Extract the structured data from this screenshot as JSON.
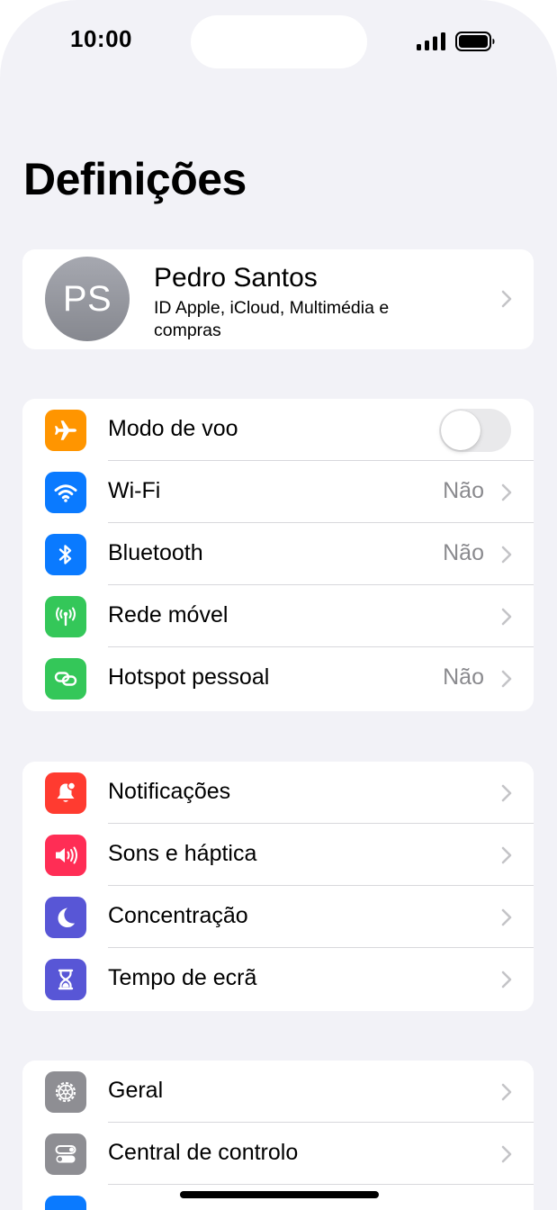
{
  "status": {
    "time": "10:00"
  },
  "page": {
    "title": "Definições"
  },
  "profile": {
    "initials": "PS",
    "name": "Pedro Santos",
    "subtitle": "ID Apple, iCloud, Multimédia e compras"
  },
  "connectivity": {
    "airplane": {
      "label": "Modo de voo",
      "toggle_on": false,
      "icon": "airplane-icon",
      "color": "#ff9500"
    },
    "wifi": {
      "label": "Wi-Fi",
      "value": "Não",
      "icon": "wifi-icon",
      "color": "#0a7aff"
    },
    "bluetooth": {
      "label": "Bluetooth",
      "value": "Não",
      "icon": "bluetooth-icon",
      "color": "#0a7aff"
    },
    "cellular": {
      "label": "Rede móvel",
      "icon": "antenna-icon",
      "color": "#34c759"
    },
    "hotspot": {
      "label": "Hotspot pessoal",
      "value": "Não",
      "icon": "link-icon",
      "color": "#34c759"
    }
  },
  "attention": {
    "notifications": {
      "label": "Notificações",
      "icon": "bell-icon",
      "color": "#ff3b30"
    },
    "sounds": {
      "label": "Sons e háptica",
      "icon": "speaker-icon",
      "color": "#ff2d55"
    },
    "focus": {
      "label": "Concentração",
      "icon": "moon-icon",
      "color": "#5856d6"
    },
    "screen_time": {
      "label": "Tempo de ecrã",
      "icon": "hourglass-icon",
      "color": "#5856d6"
    }
  },
  "general": {
    "general": {
      "label": "Geral",
      "icon": "gear-icon",
      "color": "#8e8e93"
    },
    "control_center": {
      "label": "Central de controlo",
      "icon": "switches-icon",
      "color": "#8e8e93"
    }
  }
}
